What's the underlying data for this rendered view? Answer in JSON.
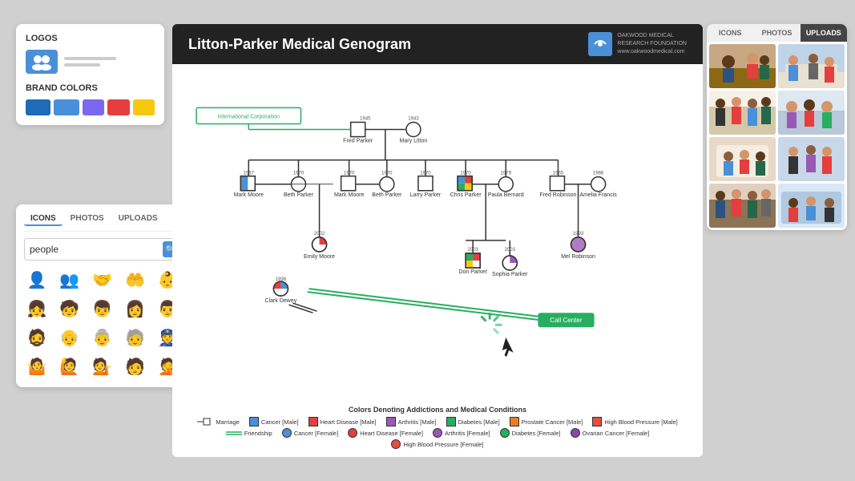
{
  "left_panel": {
    "logos_title": "LOGOS",
    "brand_colors_title": "BRAND COLORS",
    "swatches": [
      "#1e6bb8",
      "#4a90d9",
      "#7b68ee",
      "#e53e3e",
      "#f6c90e"
    ]
  },
  "icons_panel": {
    "tabs": [
      "ICONS",
      "PHOTOS",
      "UPLOADS"
    ],
    "active_tab": "ICONS",
    "search_value": "people",
    "icons": [
      "👤",
      "👥",
      "🤝",
      "🤲",
      "👶",
      "👧",
      "🧒",
      "👦",
      "👩",
      "👨",
      "🧔",
      "👴",
      "👵",
      "🧓",
      "👮",
      "🤷",
      "🙋",
      "💁",
      "🧑",
      "🤦"
    ]
  },
  "right_panel": {
    "tabs": [
      "ICONS",
      "PHOTOS",
      "UPLOADS"
    ],
    "active_tab": "UPLOADS"
  },
  "genogram": {
    "title": "Litton-Parker Medical Genogram",
    "foundation": "OAKWOOD MEDICAL\nRESEARCH FOUNDATION\nwww.oakwoodmedical.com"
  },
  "legend": {
    "title": "Colors Denoting Addictions and Medical Conditions",
    "items": [
      {
        "symbol": "square",
        "label": "Marriage"
      },
      {
        "symbol": "square",
        "color": "#4a90d9",
        "label": "Cancer [Male]"
      },
      {
        "symbol": "square",
        "color": "#e53e3e",
        "label": "Heart Disease [Male]"
      },
      {
        "symbol": "square",
        "color": "#9b59b6",
        "label": "Arthritis [Male]"
      },
      {
        "symbol": "square",
        "color": "#27ae60",
        "label": "Diabetes [Male]"
      },
      {
        "symbol": "square",
        "color": "#e67e22",
        "label": "Prostate Cancer [Male]"
      },
      {
        "symbol": "square",
        "color": "#e74c3c",
        "label": "High Blood Pressure [Male]"
      },
      {
        "symbol": "circle",
        "color": "#4a90d9",
        "label": "Cancer [Female]"
      },
      {
        "symbol": "circle",
        "color": "#e53e3e",
        "label": "Heart Disease [Female]"
      },
      {
        "symbol": "circle",
        "color": "#9b59b6",
        "label": "Arthritis [Female]"
      },
      {
        "symbol": "circle",
        "color": "#27ae60",
        "label": "Diabetes [Female]"
      },
      {
        "symbol": "circle",
        "color": "#8e44ad",
        "label": "Ovarian Cancer [Female]"
      },
      {
        "symbol": "circle",
        "color": "#e74c3c",
        "label": "High Blood Pressure [Female]"
      },
      {
        "symbol": "line",
        "color": "#27ae60",
        "label": "Friendship"
      }
    ]
  }
}
